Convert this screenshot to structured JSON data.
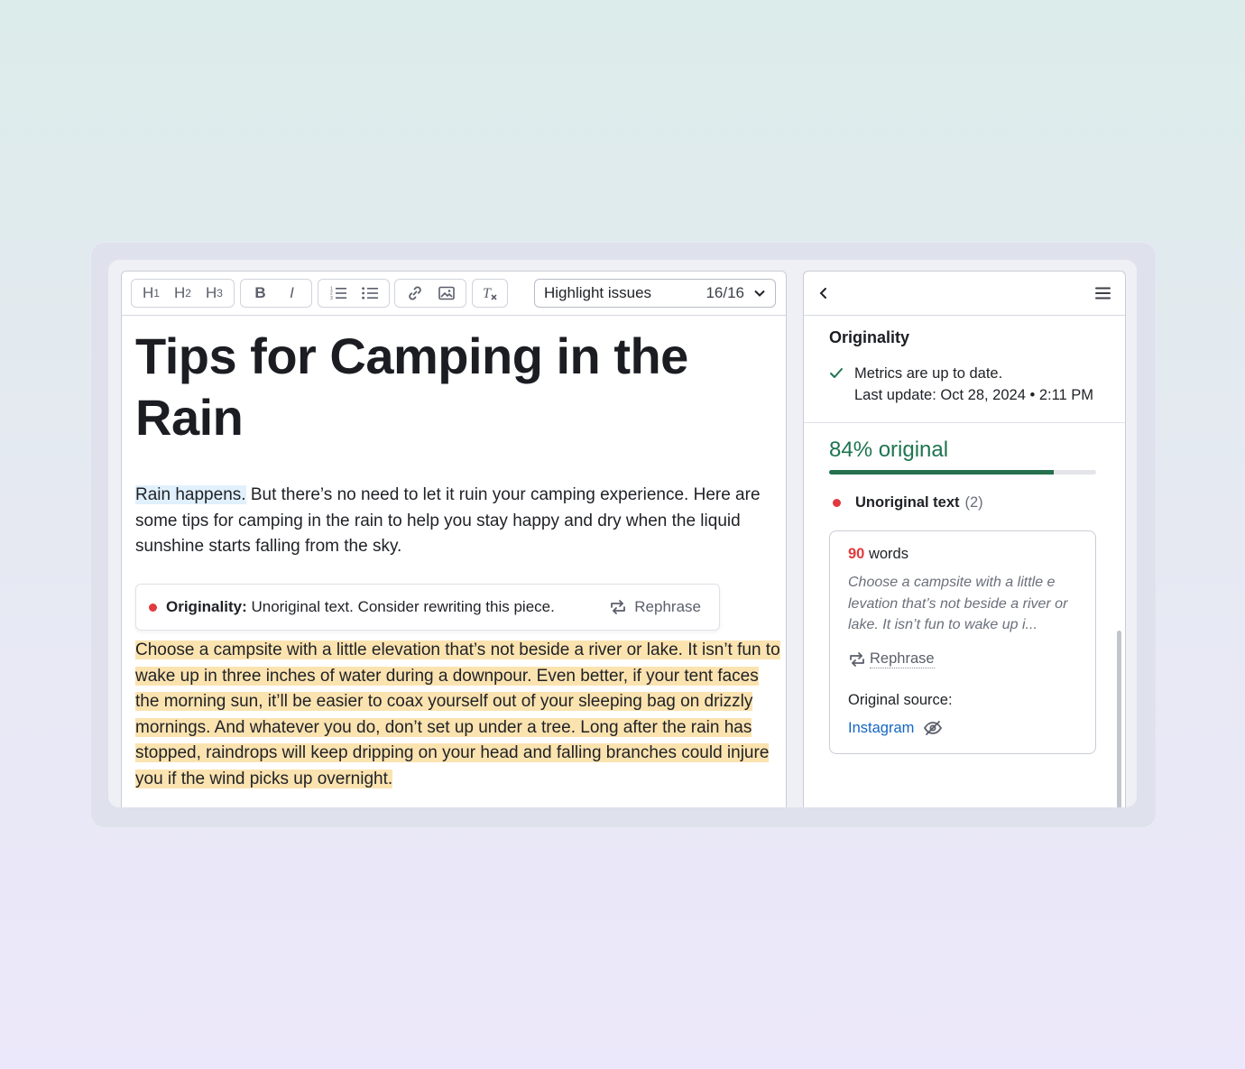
{
  "toolbar": {
    "h1": "H",
    "h1_sub": "1",
    "h2": "H",
    "h2_sub": "2",
    "h3": "H",
    "h3_sub": "3",
    "bold": "B",
    "italic": "I",
    "highlight_select": {
      "label": "Highlight issues",
      "count": "16/16"
    }
  },
  "document": {
    "title": "Tips for Camping in the Rain",
    "intro_highlight": "Rain happens.",
    "intro_rest": " But there’s no need to let it ruin your camping experience. Here are some tips for camping in the rain to help you stay happy and dry when the liquid sunshine starts falling from the sky.",
    "notice": {
      "label": "Originality:",
      "message": " Unoriginal text. Consider rewriting this piece.",
      "action": "Rephrase"
    },
    "highlighted_para": "Choose a campsite with a little elevation that’s not beside a river or lake. It isn’t fun to wake up in three inches of water during a downpour. Even better, if your tent faces the morning sun, it’ll be easier to coax yourself out of your sleeping bag on drizzly mornings. And whatever you do, don’t set up under a tree. Long after the rain has stopped, raindrops will keep dripping on your head and falling branches could injure you if the wind picks up overnight."
  },
  "panel": {
    "title": "Originality",
    "status_line1": "Metrics are up to date.",
    "status_line2": "Last update: Oct 28, 2024 • 2:11 PM",
    "percent_label": "84% original",
    "percent_value": 0.84,
    "unoriginal_label": "Unoriginal text",
    "unoriginal_count": "(2)",
    "card": {
      "word_count": "90",
      "words_label": " words",
      "snippet": "Choose a campsite with a little e levation that’s not beside a river or lake. It isn’t fun to wake up i...",
      "rephrase": "Rephrase",
      "source_label": "Original source:",
      "source_link": "Instagram"
    }
  },
  "colors": {
    "accent_green": "#1e7550",
    "alert_red": "#e03a3e",
    "link_blue": "#1466c4",
    "highlight_yellow": "#fbe3b0",
    "highlight_blue": "#e0f0fc"
  },
  "icons": [
    "numbered-list-icon",
    "bulleted-list-icon",
    "link-icon",
    "image-icon",
    "clear-format-icon",
    "chevron-down-icon",
    "back-arrow-icon",
    "menu-icon",
    "check-icon",
    "rephrase-icon",
    "hidden-eye-icon"
  ]
}
